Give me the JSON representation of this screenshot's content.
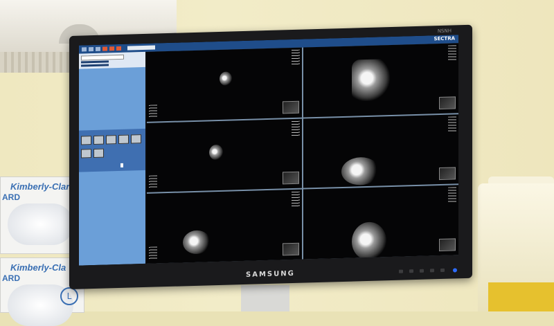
{
  "monitor": {
    "brand": "SAMSUNG",
    "model_label": "NSNH",
    "app_logo": "SECTRA"
  },
  "boxes": [
    {
      "brand": "Kimberly-Clark",
      "word": "ARD"
    },
    {
      "brand": "Kimberly-Cla",
      "word": "ARD",
      "size": "L"
    }
  ],
  "viewer": {
    "tiles": [
      "tile-1",
      "tile-2",
      "tile-3",
      "tile-4",
      "tile-5",
      "tile-6"
    ]
  }
}
